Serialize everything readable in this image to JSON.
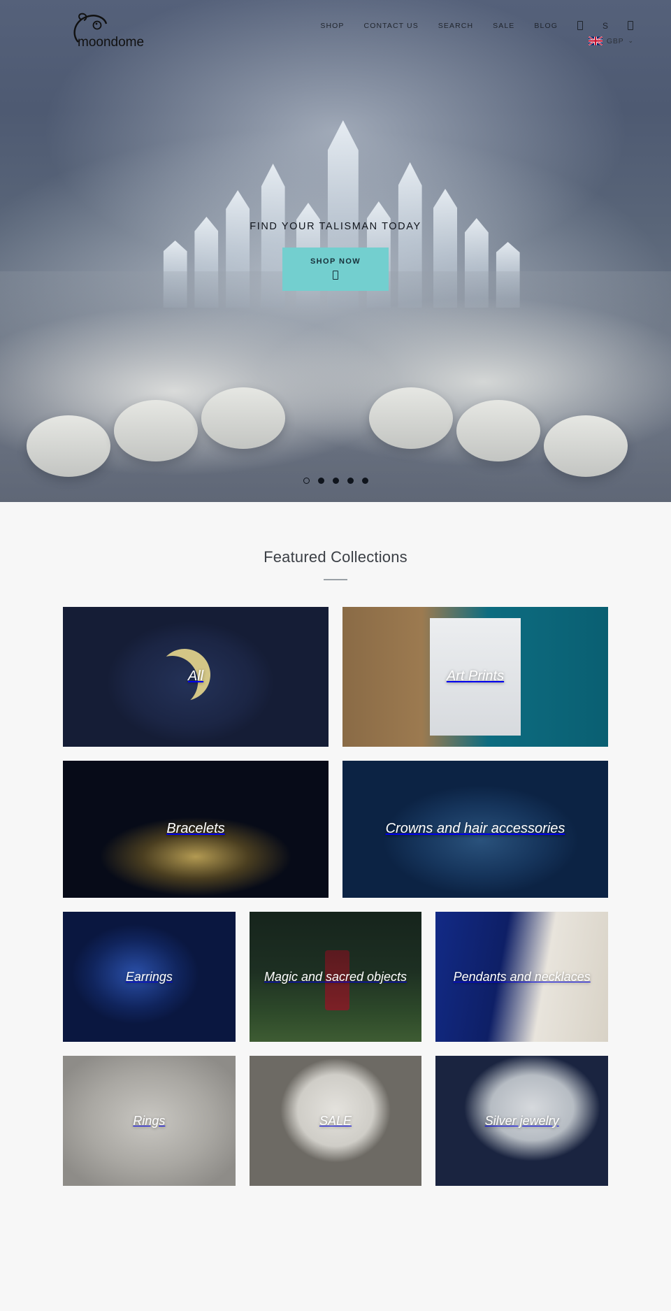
{
  "brand": {
    "name": "moondome",
    "logo_icon": "crescent-moon-logo"
  },
  "nav": {
    "links": [
      {
        "label": "SHOP"
      },
      {
        "label": "CONTACT US"
      },
      {
        "label": "SEARCH"
      },
      {
        "label": "SALE"
      },
      {
        "label": "BLOG"
      }
    ],
    "icons": [
      {
        "name": "account-icon",
        "glyph": "□"
      },
      {
        "name": "search-shortcut",
        "glyph": "S"
      },
      {
        "name": "cart-icon",
        "glyph": "□"
      }
    ]
  },
  "currency": {
    "code": "GBP",
    "flag_icon": "uk-flag-icon",
    "caret": "⌄"
  },
  "hero": {
    "title": "FIND YOUR TALISMAN TODAY",
    "cta_label": "SHOP NOW",
    "cta_glyph": "□",
    "accent_color": "#73cfcf",
    "background_color": "#4a566e",
    "slides_total": 5,
    "active_slide": 1
  },
  "featured": {
    "heading": "Featured Collections",
    "rows": [
      [
        {
          "label": "All",
          "art": "art-all"
        },
        {
          "label": "Art Prints",
          "art": "art-prints"
        }
      ],
      [
        {
          "label": "Bracelets",
          "art": "art-bracelets"
        },
        {
          "label": "Crowns and hair accessories",
          "art": "art-crowns"
        }
      ],
      [
        {
          "label": "Earrings",
          "art": "art-earrings"
        },
        {
          "label": "Magic and sacred objects",
          "art": "art-magic"
        },
        {
          "label": "Pendants and necklaces",
          "art": "art-pendants"
        }
      ],
      [
        {
          "label": "Rings",
          "art": "art-rings"
        },
        {
          "label": "SALE",
          "art": "art-sale"
        },
        {
          "label": "Silver jewelry",
          "art": "art-silver"
        }
      ]
    ]
  },
  "colors": {
    "page_background": "#f7f7f7",
    "text_dark": "#3b3f45",
    "accent": "#73cfcf"
  }
}
